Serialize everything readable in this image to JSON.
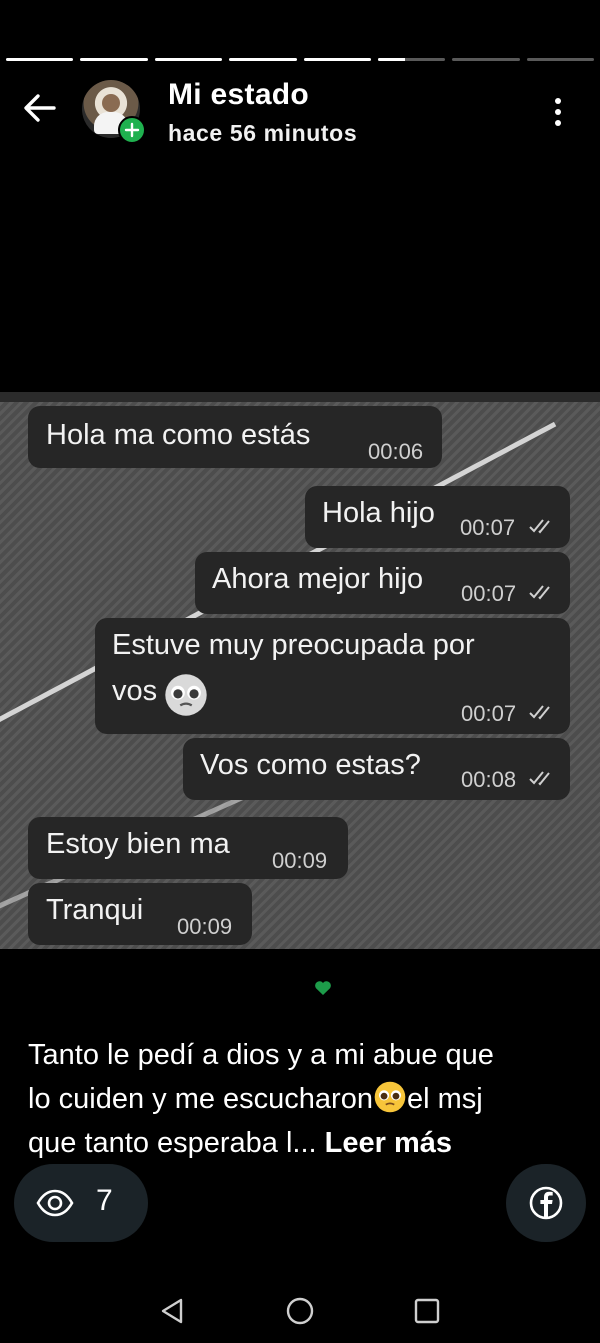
{
  "status": {
    "title": "Mi estado",
    "subtitle": "hace 56 minutos",
    "progress_segments": [
      1,
      1,
      1,
      1,
      1,
      0.4,
      0,
      0
    ]
  },
  "screenshot": {
    "messages": [
      {
        "text": "Hola ma como estás",
        "time": "00:06",
        "outgoing": false
      },
      {
        "text": "Hola hijo",
        "time": "00:07",
        "outgoing": true
      },
      {
        "text": "Ahora mejor hijo",
        "time": "00:07",
        "outgoing": true
      },
      {
        "text": "Estuve muy preocupada por",
        "text2": "vos",
        "time": "00:07",
        "outgoing": true
      },
      {
        "text": "Vos como estas?",
        "time": "00:08",
        "outgoing": true
      },
      {
        "text": "Estoy bien ma",
        "time": "00:09",
        "outgoing": false
      },
      {
        "text": "Tranqui",
        "time": "00:09",
        "outgoing": false
      }
    ]
  },
  "caption": {
    "line1": "Tanto le pedí a dios y a mi abue que",
    "line2a": "lo cuiden y me escucharon",
    "line2b": "el msj",
    "line3": "que tanto esperaba l... ",
    "more": "Leer más"
  },
  "footer": {
    "views_count": "7"
  },
  "colors": {
    "accent_green": "#1fb14f",
    "heart_green": "#1d9c4a",
    "bubble_bg": "#262626",
    "pill_bg": "#1b2328"
  }
}
